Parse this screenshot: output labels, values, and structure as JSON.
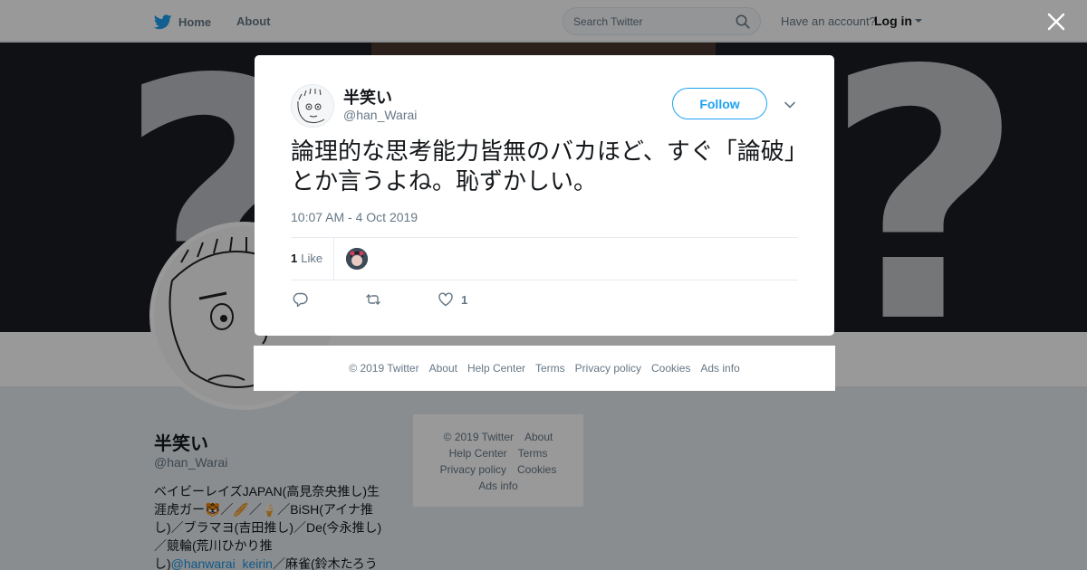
{
  "nav": {
    "home_label": "Home",
    "about_label": "About",
    "search_placeholder": "Search Twitter",
    "have_account": "Have an account?",
    "login_label": "Log in"
  },
  "profile": {
    "name": "半笑い",
    "handle": "@han_Warai",
    "bio_text": "ベイビーレイズJAPAN(高見奈央推し)生涯虎ガー🐯／🥖／🍦／BiSH(アイナ推し)／ブラマヨ(吉田推し)／De(今永推し)／競輪(荒川ひかり推し)",
    "bio_link": "@hanwarai_keirin",
    "bio_tail": "／麻雀(鈴木たろう"
  },
  "side_footer": {
    "row1": [
      "© 2019 Twitter",
      "About"
    ],
    "row2": [
      "Help Center",
      "Terms"
    ],
    "row3": [
      "Privacy policy",
      "Cookies"
    ],
    "row4": [
      "Ads info"
    ]
  },
  "tweet": {
    "author_name": "半笑い",
    "author_handle": "@han_Warai",
    "follow_label": "Follow",
    "text": "論理的な思考能力皆無のバカほど、すぐ「論破」とか言うよね。恥ずかしい。",
    "timestamp": "10:07 AM - 4 Oct 2019",
    "likes_count": "1",
    "likes_label": "Like",
    "action_like_count": "1"
  },
  "modal_footer": {
    "links": [
      "© 2019 Twitter",
      "About",
      "Help Center",
      "Terms",
      "Privacy policy",
      "Cookies",
      "Ads info"
    ]
  },
  "colors": {
    "brand": "#1da1f2",
    "text_primary": "#14171a",
    "text_secondary": "#657786",
    "link": "#1b95e0"
  },
  "icons": [
    "twitter-bird-icon",
    "search-icon",
    "caret-down-icon",
    "close-icon",
    "chevron-down-icon",
    "reply-icon",
    "retweet-icon",
    "heart-icon"
  ]
}
